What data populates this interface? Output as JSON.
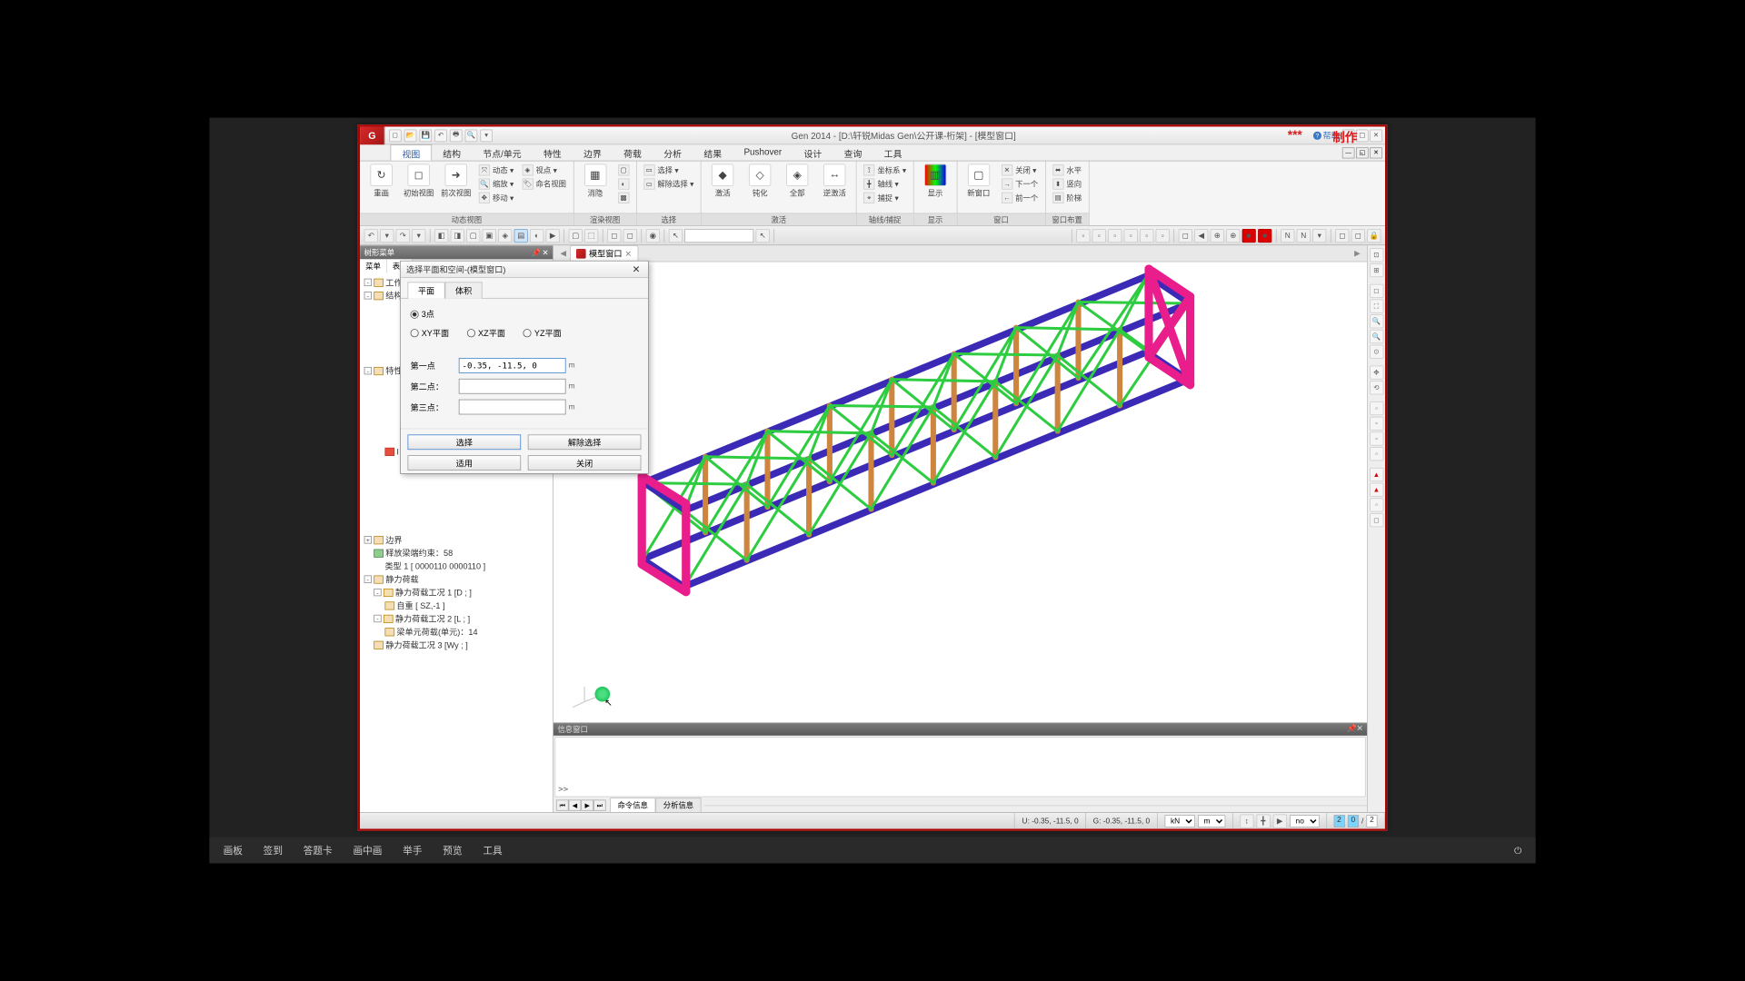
{
  "title": "Gen 2014 - [D:\\轩锐Midas Gen\\公开课-桁架] - [模型窗口]",
  "overlay_stars": "***",
  "overlay_cn": "制作",
  "help_label": "帮助",
  "qat_icons": [
    "new-icon",
    "open-icon",
    "save-icon",
    "undo-icon",
    "print-icon",
    "find-icon",
    "dropdown-icon"
  ],
  "ribbon_tabs": [
    "视图",
    "结构",
    "节点/单元",
    "特性",
    "边界",
    "荷载",
    "分析",
    "结果",
    "Pushover",
    "设计",
    "查询",
    "工具"
  ],
  "active_tab_index": 0,
  "ribbon_groups": {
    "g1": {
      "label": "动态视图",
      "big": [
        {
          "name": "refresh",
          "label": "重画",
          "glyph": "↻"
        },
        {
          "name": "initial-view",
          "label": "初始视图",
          "glyph": "◻"
        },
        {
          "name": "prev-view",
          "label": "前次视图",
          "glyph": "➜"
        }
      ],
      "small": [
        {
          "name": "dynamic",
          "label": "动态 ▾",
          "glyph": "⤧"
        },
        {
          "name": "zoom",
          "label": "缩放 ▾",
          "glyph": "🔍"
        },
        {
          "name": "move",
          "label": "移动 ▾",
          "glyph": "✥"
        }
      ],
      "small2": [
        {
          "name": "viewpoint",
          "label": "视点 ▾",
          "glyph": "◈"
        },
        {
          "name": "named-view",
          "label": "命名视图",
          "glyph": "🏷"
        }
      ]
    },
    "g2": {
      "label": "渲染视图",
      "big": [
        {
          "name": "hidden-line",
          "label": "消隐",
          "glyph": "▦"
        }
      ],
      "small": [
        {
          "name": "shrink",
          "label": "",
          "glyph": "▢"
        },
        {
          "name": "persp",
          "label": "",
          "glyph": "◐"
        },
        {
          "name": "wire",
          "label": "",
          "glyph": "▩"
        }
      ]
    },
    "g3": {
      "label": "选择",
      "small": [
        {
          "name": "select",
          "label": "选择 ▾",
          "glyph": "▭"
        },
        {
          "name": "unselect",
          "label": "解除选择 ▾",
          "glyph": "▭"
        }
      ]
    },
    "g4": {
      "label": "激活",
      "big": [
        {
          "name": "activate",
          "label": "激活",
          "glyph": "◆"
        },
        {
          "name": "inactivate",
          "label": "钝化",
          "glyph": "◇"
        },
        {
          "name": "all",
          "label": "全部",
          "glyph": "◈"
        },
        {
          "name": "inverse",
          "label": "逆激活",
          "glyph": "↔"
        }
      ]
    },
    "g5": {
      "label": "轴线/捕捉",
      "small": [
        {
          "name": "ucs",
          "label": "坐标系 ▾",
          "glyph": "⟟"
        },
        {
          "name": "grid",
          "label": "轴线 ▾",
          "glyph": "╋"
        },
        {
          "name": "snap",
          "label": "捕捉 ▾",
          "glyph": "⌖"
        }
      ]
    },
    "g6": {
      "label": "显示",
      "big": [
        {
          "name": "display",
          "label": "显示",
          "glyph": "▥"
        }
      ]
    },
    "g7": {
      "label": "窗口",
      "big": [
        {
          "name": "new-win",
          "label": "新窗口",
          "glyph": "▢"
        }
      ],
      "small": [
        {
          "name": "close",
          "label": "关闭 ▾",
          "glyph": "✕"
        },
        {
          "name": "next",
          "label": "下一个",
          "glyph": "→"
        },
        {
          "name": "prev",
          "label": "前一个",
          "glyph": "←"
        }
      ]
    },
    "g8": {
      "label": "窗口布置",
      "small": [
        {
          "name": "horiz",
          "label": "水平",
          "glyph": "⬌"
        },
        {
          "name": "vert",
          "label": "竖向",
          "glyph": "⬍"
        },
        {
          "name": "cascade",
          "label": "阶梯",
          "glyph": "▤"
        }
      ]
    }
  },
  "left_panel": {
    "title": "树形菜单",
    "tabs": [
      "菜单",
      "表..."
    ],
    "nodes": [
      {
        "ind": 0,
        "box": "",
        "ico": "",
        "text": "工作"
      },
      {
        "ind": 0,
        "box": "-",
        "ico": "",
        "text": "结构"
      },
      {
        "ind": 1,
        "box": "-",
        "ico": "",
        "text": "特性"
      },
      {
        "ind": 2,
        "box": "",
        "ico": "red",
        "text": "I"
      },
      {
        "ind": 0,
        "box": "+",
        "ico": "",
        "text": "边界"
      },
      {
        "ind": 1,
        "box": "",
        "ico": "grn",
        "text": "释放梁端约束：58"
      },
      {
        "ind": 2,
        "box": "",
        "ico": "",
        "text": "类型 1 [ 0000110 0000110 ]"
      },
      {
        "ind": 0,
        "box": "-",
        "ico": "",
        "text": "静力荷载"
      },
      {
        "ind": 1,
        "box": "-",
        "ico": "",
        "text": "静力荷载工况 1 [D ; ]"
      },
      {
        "ind": 2,
        "box": "",
        "ico": "",
        "text": "自重 [ SZ,-1 ]"
      },
      {
        "ind": 1,
        "box": "-",
        "ico": "",
        "text": "静力荷载工况 2 [L ; ]"
      },
      {
        "ind": 2,
        "box": "",
        "ico": "",
        "text": "梁单元荷载(单元)：14"
      },
      {
        "ind": 1,
        "box": "",
        "ico": "",
        "text": "静力荷载工况 3 [Wy ; ]"
      }
    ]
  },
  "dialog": {
    "title": "选择平面和空间-(模型窗口)",
    "tabs": [
      "平面",
      "体积"
    ],
    "radios": [
      "3点",
      "XY平面",
      "XZ平面",
      "YZ平面"
    ],
    "selected_radio": 0,
    "field1_label": "第一点",
    "field1_value": "-0.35, -11.5, 0",
    "field2_label": "第二点：",
    "field2_value": "",
    "field3_label": "第三点：",
    "field3_value": "",
    "unit": "m",
    "btn_select": "选择",
    "btn_unselect": "解除选择",
    "btn_apply": "适用",
    "btn_close": "关闭"
  },
  "view_tab": "模型窗口",
  "info_title": "信息窗口",
  "info_prompt": ">>",
  "info_tabs": [
    "命令信息",
    "分析信息"
  ],
  "status": {
    "u_coord": "U: -0.35, -11.5, 0",
    "g_coord": "G: -0.35, -11.5, 0",
    "unit_force": "kN",
    "unit_len": "m",
    "unit_snap": "no",
    "val1": "2",
    "val2": "0",
    "sep": "/",
    "val3": "2"
  },
  "bottombar": [
    "画板",
    "签到",
    "答题卡",
    "画中画",
    "举手",
    "预览",
    "工具"
  ]
}
